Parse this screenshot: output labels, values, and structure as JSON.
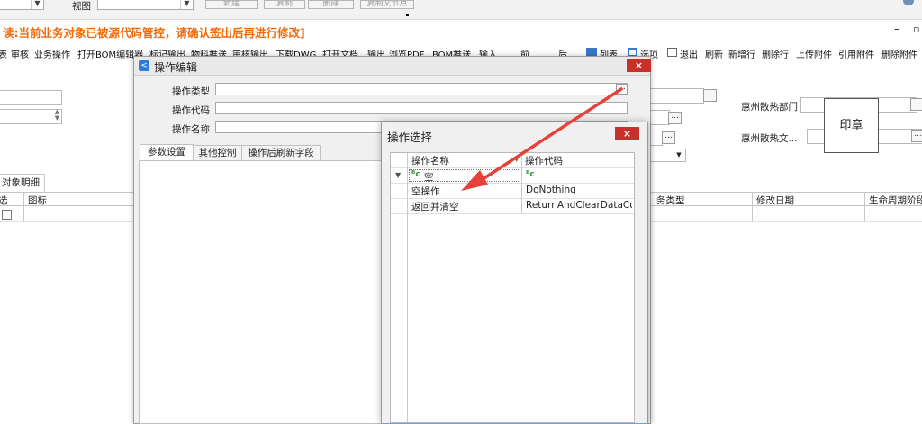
{
  "top_strip": {
    "view_label": "视图",
    "buttons": [
      "新建",
      "复制",
      "删除",
      "复制父节点"
    ]
  },
  "warning": "读:当前业务对象已被源代码管控，请确认签出后再进行修改]",
  "toolbar": {
    "items": [
      "表",
      "审核",
      "业务操作",
      "打开BOM编辑器",
      "标记输出",
      "物料推送",
      "审核输出",
      "下载DWG",
      "打开文档",
      "输出",
      "浏览PDF",
      "BOM推送",
      "输入",
      "前",
      "后"
    ],
    "right_items": [
      "列表",
      "选项",
      "退出",
      "刷新",
      "新增行",
      "删除行",
      "上传附件",
      "引用附件",
      "删除附件"
    ]
  },
  "form": {
    "dept_label": "惠州散热部门",
    "doc_label": "惠州散热文...",
    "seal_text": "印章"
  },
  "left_tab": "对象明细",
  "grid_headers": {
    "select": "选",
    "icon": "图标",
    "task_type": "务类型",
    "modify_date": "修改日期",
    "lifecycle": "生命周期阶段"
  },
  "dialog1": {
    "title": "操作编辑",
    "close": "×",
    "fields": {
      "type_label": "操作类型",
      "code_label": "操作代码",
      "name_label": "操作名称"
    },
    "tabs": [
      "参数设置",
      "其他控制",
      "操作后刷新字段"
    ]
  },
  "dialog2": {
    "title": "操作选择",
    "close": "×",
    "columns": [
      "操作名称",
      "操作代码"
    ],
    "filter_row": {
      "name": "空",
      "code": ""
    },
    "rows": [
      {
        "name": "空操作",
        "code": "DoNothing"
      },
      {
        "name": "返回并清空",
        "code": "ReturnAndClearDataColl..."
      }
    ]
  },
  "colors": {
    "warning": "#f26b0a",
    "close_button": "#c9302c",
    "arrow": "#e8403a"
  }
}
